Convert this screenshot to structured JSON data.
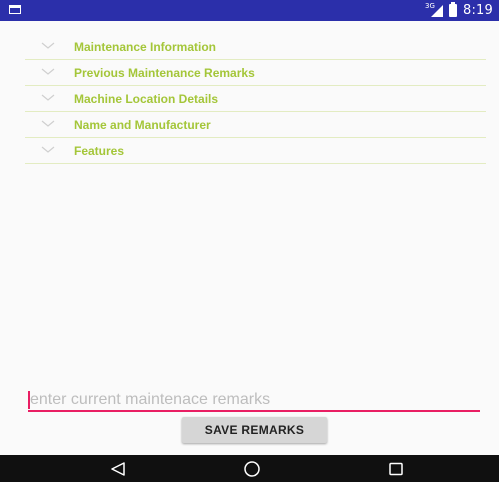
{
  "status_bar": {
    "network_label": "3G",
    "time": "8:19",
    "background_color": "#2b2faa"
  },
  "accordion": {
    "accent_color": "#a4c639",
    "items": [
      {
        "label": "Maintenance Information",
        "icon": "chevron-down-icon"
      },
      {
        "label": "Previous Maintenance Remarks",
        "icon": "chevron-down-icon"
      },
      {
        "label": "Machine Location Details",
        "icon": "chevron-down-icon"
      },
      {
        "label": "Name and Manufacturer",
        "icon": "chevron-down-icon"
      },
      {
        "label": "Features",
        "icon": "chevron-down-icon"
      }
    ]
  },
  "remarks": {
    "value": "",
    "placeholder": "enter current maintenace remarks",
    "underline_color": "#e91e63"
  },
  "actions": {
    "save_label": "SAVE REMARKS"
  },
  "nav_bar": {
    "back_icon": "back-triangle-icon",
    "home_icon": "home-circle-icon",
    "recents_icon": "recents-square-icon"
  }
}
